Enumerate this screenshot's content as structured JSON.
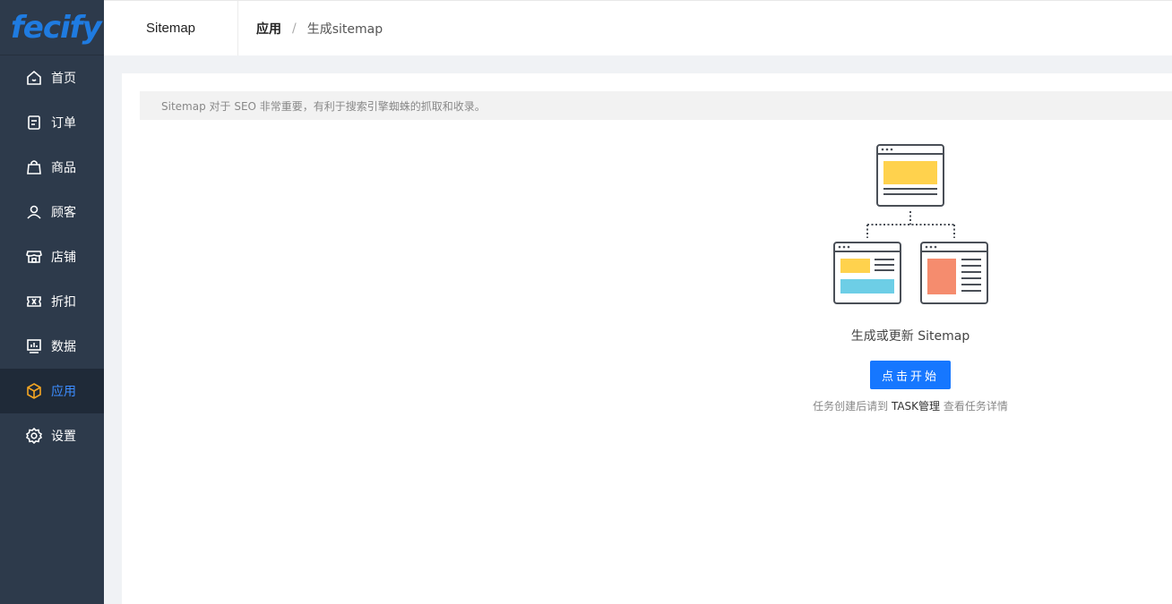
{
  "logo": {
    "text": "fecify"
  },
  "sidebar": {
    "items": [
      {
        "label": "首页",
        "icon": "home-icon"
      },
      {
        "label": "订单",
        "icon": "order-icon"
      },
      {
        "label": "商品",
        "icon": "bag-icon"
      },
      {
        "label": "顾客",
        "icon": "user-icon"
      },
      {
        "label": "店铺",
        "icon": "store-icon"
      },
      {
        "label": "折扣",
        "icon": "coupon-icon"
      },
      {
        "label": "数据",
        "icon": "chart-icon"
      },
      {
        "label": "应用",
        "icon": "cube-icon",
        "active": true
      },
      {
        "label": "设置",
        "icon": "gear-icon"
      }
    ]
  },
  "header": {
    "title": "Sitemap",
    "breadcrumb": [
      "应用",
      "/",
      "生成sitemap"
    ]
  },
  "main": {
    "notice": "Sitemap 对于 SEO 非常重要，有利于搜索引擎蜘蛛的抓取和收录。",
    "caption": "生成或更新 Sitemap",
    "start_button": "点击开始",
    "hint_before": "任务创建后请到",
    "hint_link": "TASK管理",
    "hint_after": "查看任务详情"
  },
  "colors": {
    "sidebar_bg": "#2d3a4b",
    "active_bg": "#1f2a38",
    "accent_blue": "#1677ff",
    "accent_orange": "#f5a623",
    "illus_yellow": "#ffd24d",
    "illus_cyan": "#6dcee6",
    "illus_salmon": "#f58c6e"
  }
}
